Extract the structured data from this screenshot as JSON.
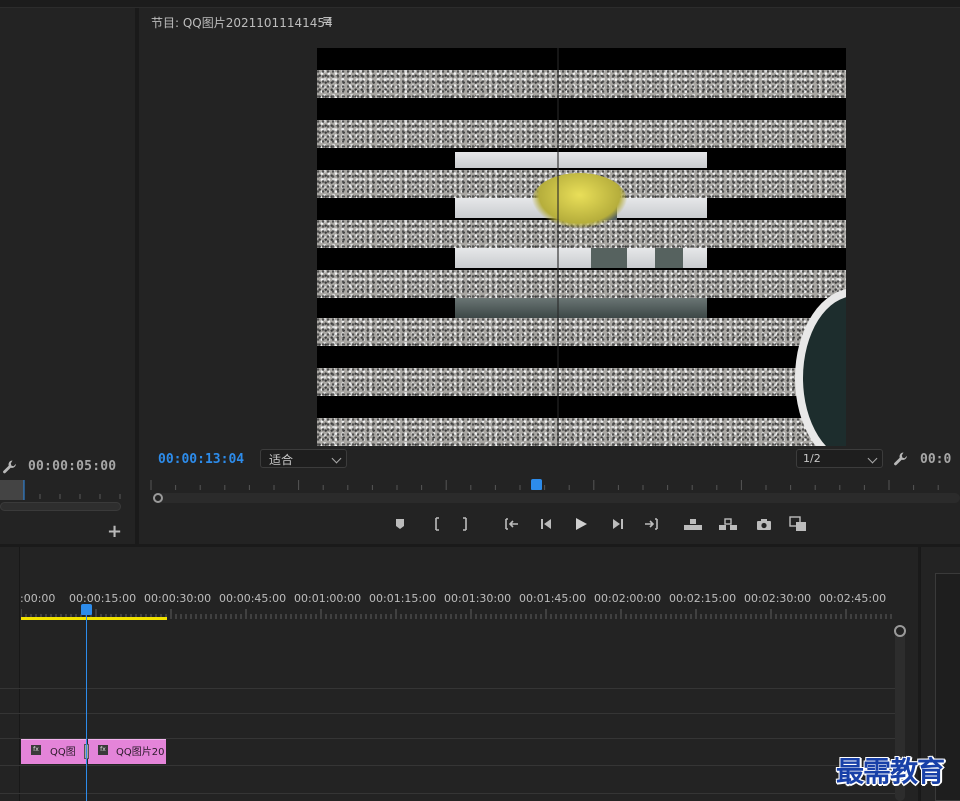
{
  "source_monitor": {
    "timecode": "00:00:05:00",
    "add_button": "+"
  },
  "program_monitor": {
    "title": "节目: QQ图片20211011141454",
    "menu_icon": "≡",
    "current_timecode": "00:00:13:04",
    "fit_option": "适合",
    "resolution_option": "1/2",
    "duration_timecode": "00:0",
    "transport_icons": [
      "marker-icon",
      "mark-in-icon",
      "mark-out-icon",
      "go-to-in-icon",
      "step-back-icon",
      "play-icon",
      "step-forward-icon",
      "go-to-out-icon",
      "lift-icon",
      "extract-icon",
      "export-frame-icon",
      "compare-icon"
    ]
  },
  "timeline": {
    "time_labels": [
      ":00:00",
      "00:00:15:00",
      "00:00:30:00",
      "00:00:45:00",
      "00:01:00:00",
      "00:01:15:00",
      "00:01:30:00",
      "00:01:45:00",
      "00:02:00:00",
      "00:02:15:00",
      "00:02:30:00",
      "00:02:45:00"
    ],
    "clips": [
      {
        "fx": "fx",
        "name": "QQ图"
      },
      {
        "fx": "fx",
        "name": "QQ图片20"
      }
    ]
  },
  "watermark": "最需教育",
  "colors": {
    "accent": "#2d8ceb",
    "work_area": "#f2e300",
    "clip": "#e484d9",
    "panel": "#232323"
  }
}
